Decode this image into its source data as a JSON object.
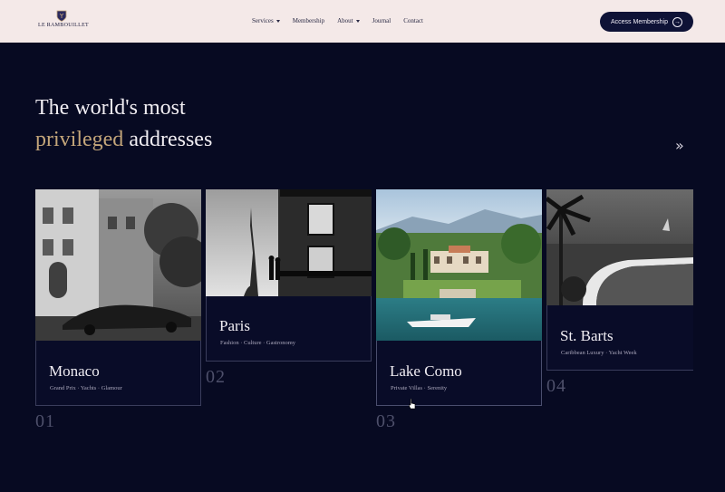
{
  "header": {
    "logo_text": "LE RAMBOUILLET",
    "nav": [
      {
        "label": "Services",
        "dropdown": true
      },
      {
        "label": "Membership",
        "dropdown": false
      },
      {
        "label": "About",
        "dropdown": true
      },
      {
        "label": "Journal",
        "dropdown": false
      },
      {
        "label": "Contact",
        "dropdown": false
      }
    ],
    "cta_label": "Access Membership"
  },
  "hero": {
    "line1": "The world's most",
    "accent": "privileged",
    "line2_rest": " addresses"
  },
  "destinations": [
    {
      "title": "Monaco",
      "tags": "Grand Prix · Yachts · Glamour",
      "number": "01"
    },
    {
      "title": "Paris",
      "tags": "Fashion · Culture · Gastronomy",
      "number": "02"
    },
    {
      "title": "Lake Como",
      "tags": "Private Villas · Serenity",
      "number": "03"
    },
    {
      "title": "St. Barts",
      "tags": "Caribbean Luxury · Yacht Week",
      "number": "04"
    }
  ],
  "colors": {
    "background": "#070a22",
    "header_bg": "#f4e9e8",
    "accent_gold": "#c4a67a",
    "cta_bg": "#0e1236"
  },
  "icons": {
    "logo": "crest-icon",
    "next": "double-chevron-right-icon",
    "cta": "arrow-right-circle-icon"
  }
}
